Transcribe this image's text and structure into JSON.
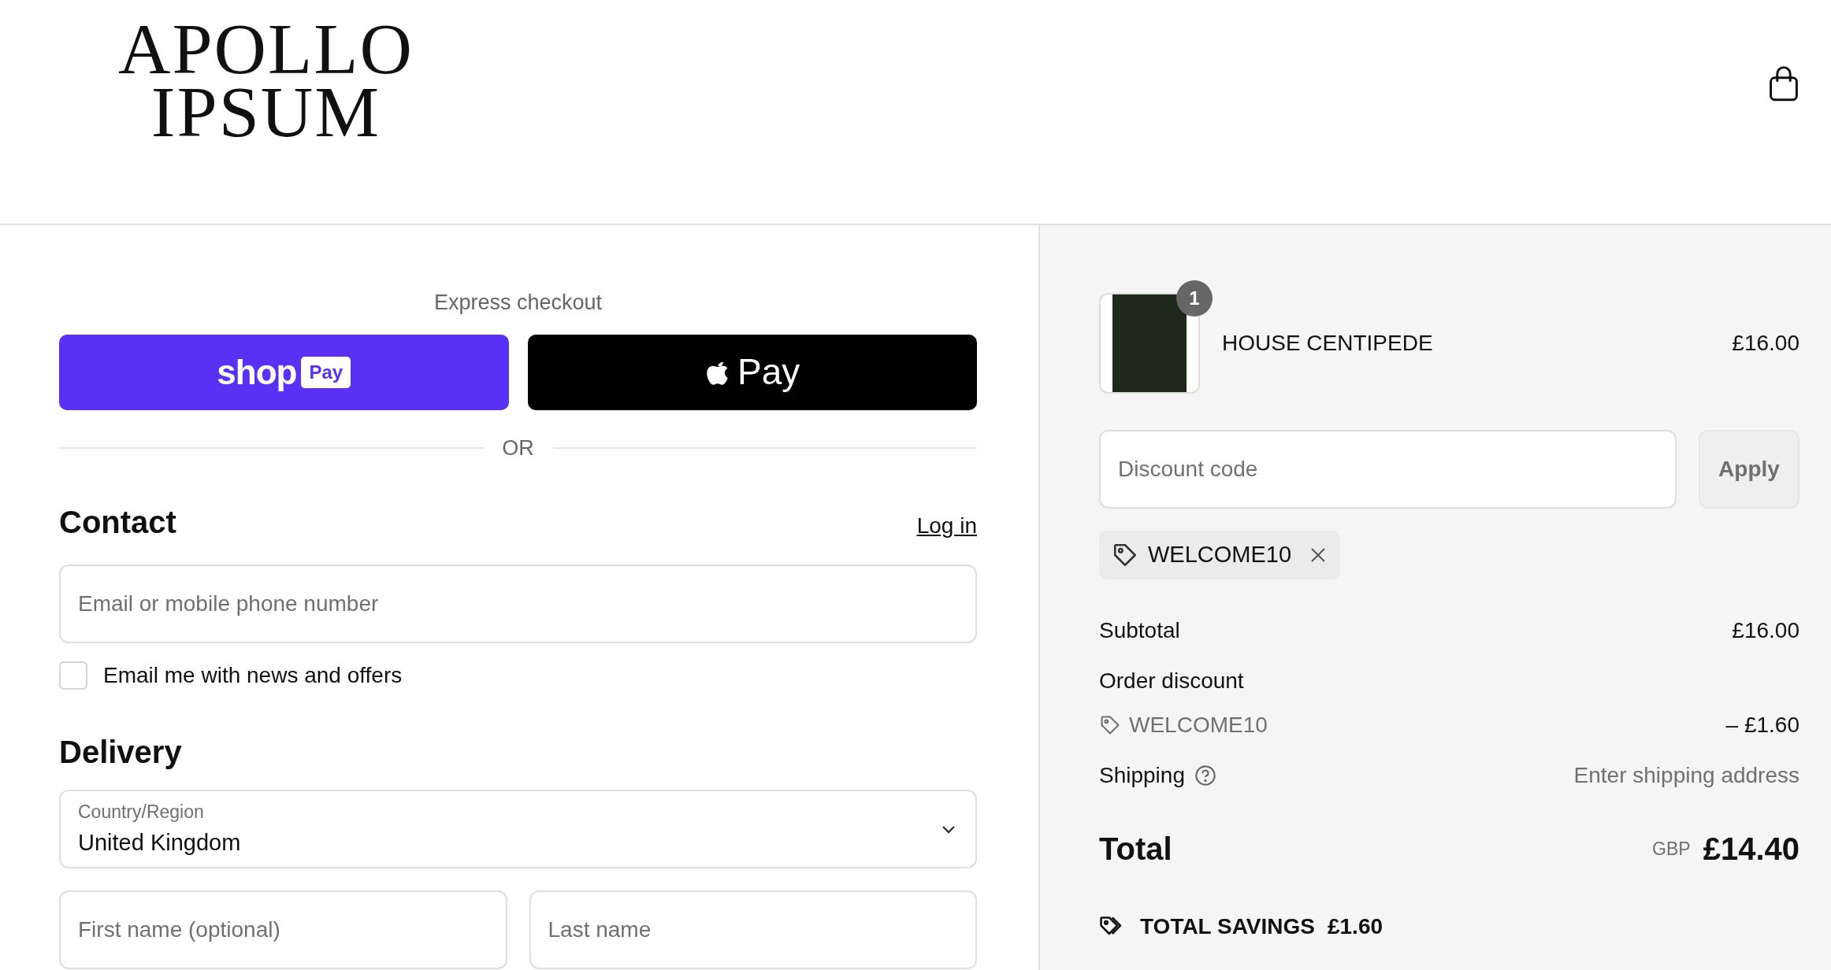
{
  "header": {
    "logo_lines": [
      "APOLLO",
      "IPSUM"
    ]
  },
  "express": {
    "title": "Express checkout",
    "shop_pay": {
      "word": "shop",
      "badge": "Pay"
    },
    "apple_pay": {
      "word": "Pay"
    },
    "divider": "OR"
  },
  "contact": {
    "title": "Contact",
    "login_link": "Log in",
    "email": {
      "placeholder": "Email or mobile phone number"
    },
    "newsletter": {
      "label": "Email me with news and offers",
      "checked": false
    }
  },
  "delivery": {
    "title": "Delivery",
    "country": {
      "label": "Country/Region",
      "value": "United Kingdom"
    },
    "name_fields": [
      {
        "placeholder": "First name (optional)"
      },
      {
        "placeholder": "Last name"
      }
    ]
  },
  "summary": {
    "item": {
      "name": "HOUSE CENTIPEDE",
      "quantity": "1",
      "price": "£16.00"
    },
    "discount": {
      "placeholder": "Discount code",
      "button": "Apply",
      "applied_code": "WELCOME10"
    },
    "subtotal": {
      "label": "Subtotal",
      "value": "£16.00"
    },
    "order_discount": {
      "label": "Order discount",
      "code": "WELCOME10",
      "value": "– £1.60"
    },
    "shipping": {
      "label": "Shipping",
      "value": "Enter shipping address"
    },
    "total": {
      "label": "Total",
      "currency": "GBP",
      "value": "£14.40"
    },
    "savings": {
      "label": "TOTAL SAVINGS",
      "value": "£1.60"
    }
  }
}
